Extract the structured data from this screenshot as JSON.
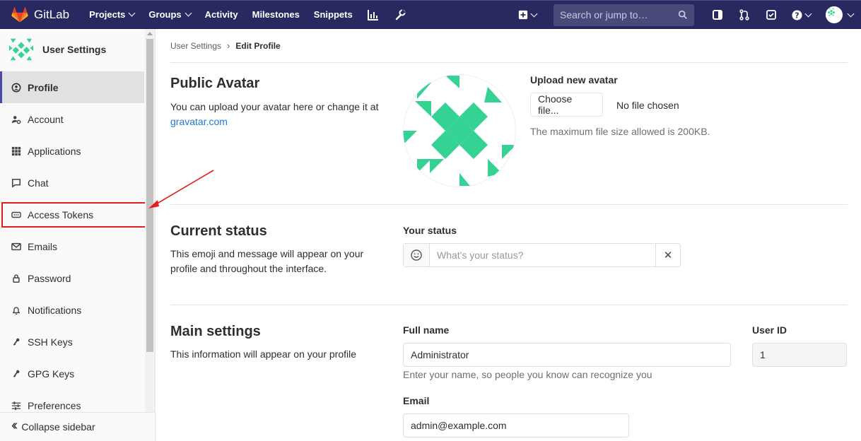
{
  "navbar": {
    "brand": "GitLab",
    "items": [
      {
        "label": "Projects",
        "dropdown": true
      },
      {
        "label": "Groups",
        "dropdown": true
      },
      {
        "label": "Activity",
        "dropdown": false
      },
      {
        "label": "Milestones",
        "dropdown": false
      },
      {
        "label": "Snippets",
        "dropdown": false
      }
    ],
    "search_placeholder": "Search or jump to…"
  },
  "sidebar": {
    "title": "User Settings",
    "items": [
      {
        "label": "Profile",
        "icon": "profile-icon",
        "active": true
      },
      {
        "label": "Account",
        "icon": "account-icon"
      },
      {
        "label": "Applications",
        "icon": "applications-icon"
      },
      {
        "label": "Chat",
        "icon": "chat-icon"
      },
      {
        "label": "Access Tokens",
        "icon": "access-token-icon"
      },
      {
        "label": "Emails",
        "icon": "email-icon"
      },
      {
        "label": "Password",
        "icon": "lock-icon"
      },
      {
        "label": "Notifications",
        "icon": "bell-icon"
      },
      {
        "label": "SSH Keys",
        "icon": "key-icon"
      },
      {
        "label": "GPG Keys",
        "icon": "key-icon"
      },
      {
        "label": "Preferences",
        "icon": "preferences-icon"
      }
    ],
    "collapse_label": "Collapse sidebar"
  },
  "breadcrumb": {
    "parent": "User Settings",
    "current": "Edit Profile"
  },
  "avatar_section": {
    "title": "Public Avatar",
    "desc": "You can upload your avatar here or change it at",
    "link": "gravatar.com",
    "upload_label": "Upload new avatar",
    "choose_button": "Choose file...",
    "file_status": "No file chosen",
    "max_size_text": "The maximum file size allowed is 200KB."
  },
  "status_section": {
    "title": "Current status",
    "desc": "This emoji and message will appear on your profile and throughout the interface.",
    "field_label": "Your status",
    "placeholder": "What's your status?",
    "clear_glyph": "✕"
  },
  "main_settings": {
    "title": "Main settings",
    "desc": "This information will appear on your profile",
    "full_name_label": "Full name",
    "full_name_value": "Administrator",
    "full_name_help": "Enter your name, so people you know can recognize you",
    "user_id_label": "User ID",
    "user_id_value": "1",
    "email_label": "Email",
    "email_value": "admin@example.com"
  },
  "colors": {
    "navbar": "#292961",
    "accent": "#4b4ba3",
    "identicon": "#34d293",
    "highlight": "#e0201e",
    "link": "#1f78d1"
  }
}
